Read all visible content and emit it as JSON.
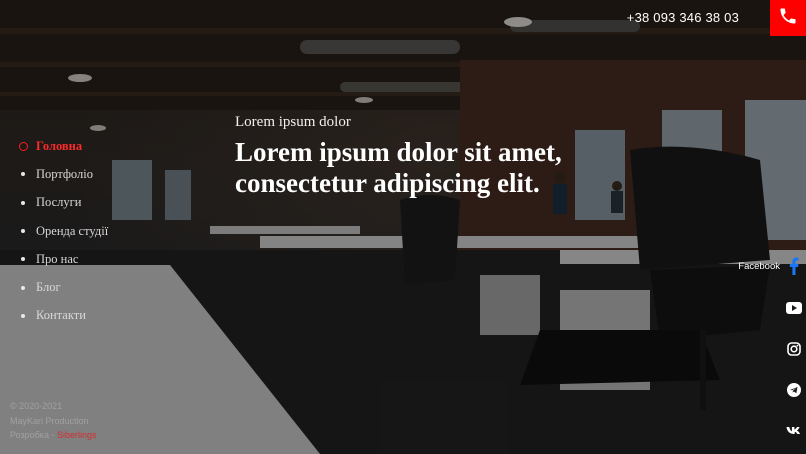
{
  "header": {
    "phone": "+38 093 346 38 03",
    "phone_icon": "phone-icon",
    "accent_color": "#ff0000"
  },
  "nav": {
    "items": [
      {
        "label": "Головна",
        "active": true
      },
      {
        "label": "Портфоліо",
        "active": false
      },
      {
        "label": "Послуги",
        "active": false
      },
      {
        "label": "Оренда студії",
        "active": false
      },
      {
        "label": "Про нас",
        "active": false
      },
      {
        "label": "Блог",
        "active": false
      },
      {
        "label": "Контакти",
        "active": false
      }
    ]
  },
  "hero": {
    "subtitle": "Lorem ipsum dolor",
    "title_line1": "Lorem ipsum dolor sit amet,",
    "title_line2": "consectetur adipiscing elit."
  },
  "footer": {
    "copyright": "© 2020-2021",
    "company": "MayKari Production",
    "dev_prefix": "Розробка - ",
    "dev_link": "Siberlings"
  },
  "social": {
    "facebook_label": "Facebook",
    "icons": [
      "facebook-icon",
      "youtube-icon",
      "instagram-icon",
      "telegram-icon",
      "vk-icon"
    ]
  }
}
